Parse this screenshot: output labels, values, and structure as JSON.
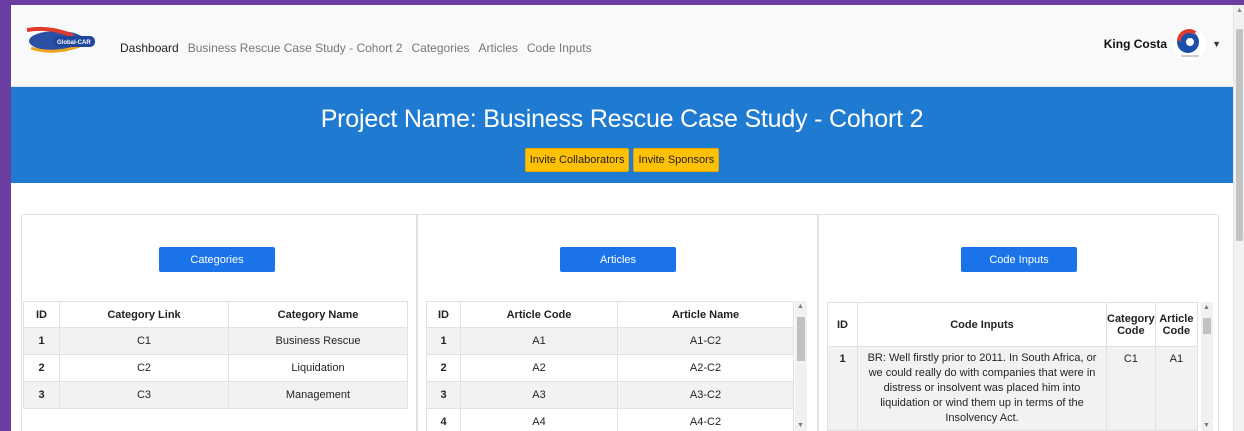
{
  "colors": {
    "frame": "#6a3ea1",
    "hero_bg": "#1e7bd1",
    "primary": "#1a73e8",
    "warning": "#ffc107"
  },
  "nav": {
    "logo_text": "Global-CAR",
    "brand": "Dashboard",
    "links": [
      "Business Rescue Case Study - Cohort 2",
      "Categories",
      "Articles",
      "Code Inputs"
    ],
    "user_name": "King Costa",
    "avatar_icon": "user-avatar-icon",
    "caret_icon": "caret-down-icon"
  },
  "hero": {
    "title": "Project Name: Business Rescue Case Study - Cohort 2",
    "invite_collaborators": "Invite Collaborators",
    "invite_sponsors": "Invite Sponsors"
  },
  "categories": {
    "button": "Categories",
    "headers": [
      "ID",
      "Category Link",
      "Category Name"
    ],
    "rows": [
      [
        "1",
        "C1",
        "Business Rescue"
      ],
      [
        "2",
        "C2",
        "Liquidation"
      ],
      [
        "3",
        "C3",
        "Management"
      ]
    ]
  },
  "articles": {
    "button": "Articles",
    "headers": [
      "ID",
      "Article Code",
      "Article Name"
    ],
    "rows": [
      [
        "1",
        "A1",
        "A1-C2"
      ],
      [
        "2",
        "A2",
        "A2-C2"
      ],
      [
        "3",
        "A3",
        "A3-C2"
      ],
      [
        "4",
        "A4",
        "A4-C2"
      ]
    ]
  },
  "code_inputs": {
    "button": "Code Inputs",
    "headers": [
      "ID",
      "Code Inputs",
      "Category Code",
      "Article Code"
    ],
    "rows": [
      [
        "1",
        "BR: Well firstly prior to 2011. In South Africa, or we could really do with companies that were in distress or insolvent was placed him into liquidation or wind them up in terms of the Insolvency Act.",
        "C1",
        "A1"
      ]
    ]
  }
}
